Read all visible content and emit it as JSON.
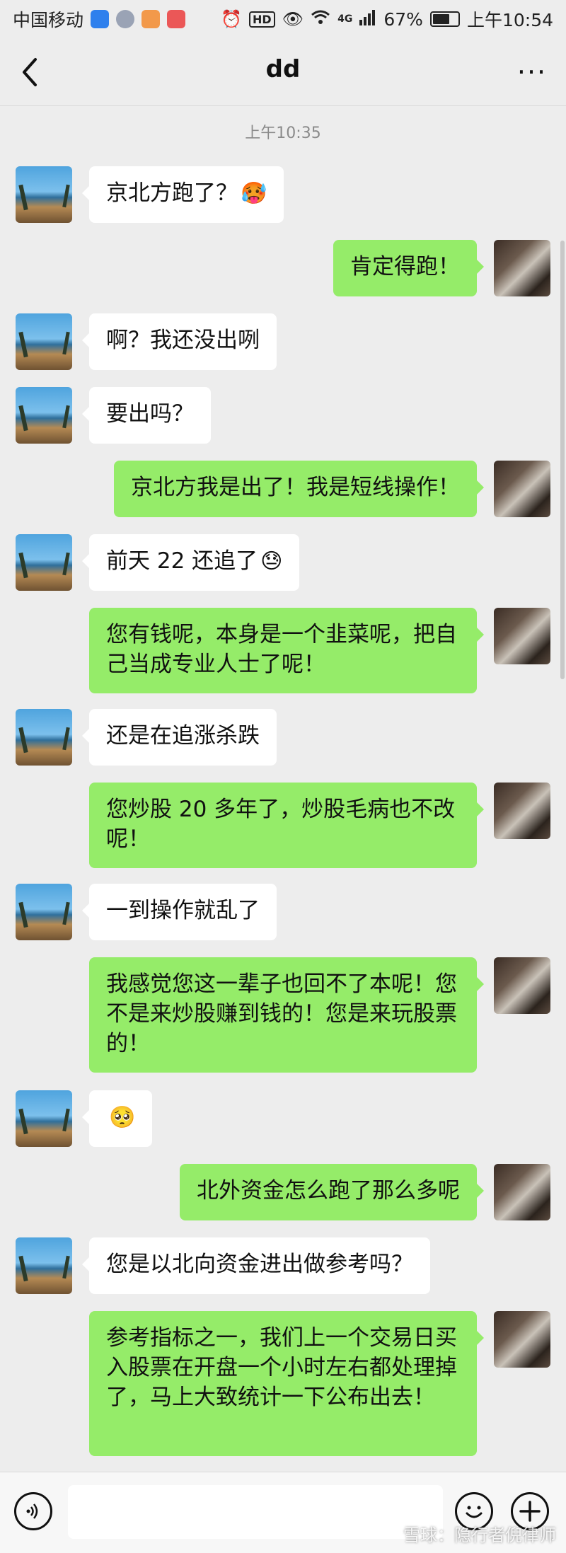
{
  "status_bar": {
    "carrier": "中国移动",
    "network_badge": "HD",
    "signal_text": "4G",
    "battery": "67%",
    "battery_level": 0.67,
    "time": "上午10:54",
    "icons": [
      "alarm-icon",
      "eye-icon",
      "wifi-icon",
      "signal-icon",
      "battery-icon"
    ]
  },
  "header": {
    "back_icon": "chevron-left-icon",
    "title": "dd",
    "more_icon": "more-dots-icon",
    "more_glyph": "···"
  },
  "chat": {
    "timestamp": "上午10:35",
    "messages": [
      {
        "side": "left",
        "text": "京北方跑了？",
        "emoji": "🥵"
      },
      {
        "side": "right",
        "text": "肯定得跑！"
      },
      {
        "side": "left",
        "text": "啊？我还没出咧"
      },
      {
        "side": "left",
        "text": "要出吗？"
      },
      {
        "side": "right",
        "text": "京北方我是出了！我是短线操作！"
      },
      {
        "side": "left",
        "text": "前天 22 还追了",
        "emoji": "😓"
      },
      {
        "side": "right",
        "text": "您有钱呢，本身是一个韭菜呢，把自己当成专业人士了呢！"
      },
      {
        "side": "left",
        "text": "还是在追涨杀跌"
      },
      {
        "side": "right",
        "text": "您炒股 20 多年了，炒股毛病也不改呢！"
      },
      {
        "side": "left",
        "text": "一到操作就乱了"
      },
      {
        "side": "right",
        "text": "我感觉您这一辈子也回不了本呢！您不是来炒股赚到钱的！您是来玩股票的！"
      },
      {
        "side": "left",
        "text": "",
        "emoji": "🥺"
      },
      {
        "side": "right",
        "text": "北外资金怎么跑了那么多呢"
      },
      {
        "side": "left",
        "text": "您是以北向资金进出做参考吗？"
      },
      {
        "side": "right",
        "text": "参考指标之一，我们上一个交易日买入股票在开盘一个小时左右都处理掉了，马上大致统计一下公布出去！"
      }
    ]
  },
  "input_bar": {
    "voice_icon": "voice-icon",
    "emoji_icon": "emoji-icon",
    "plus_icon": "plus-icon",
    "input_value": "",
    "watermark": "雪球：隐行者倪律师"
  }
}
